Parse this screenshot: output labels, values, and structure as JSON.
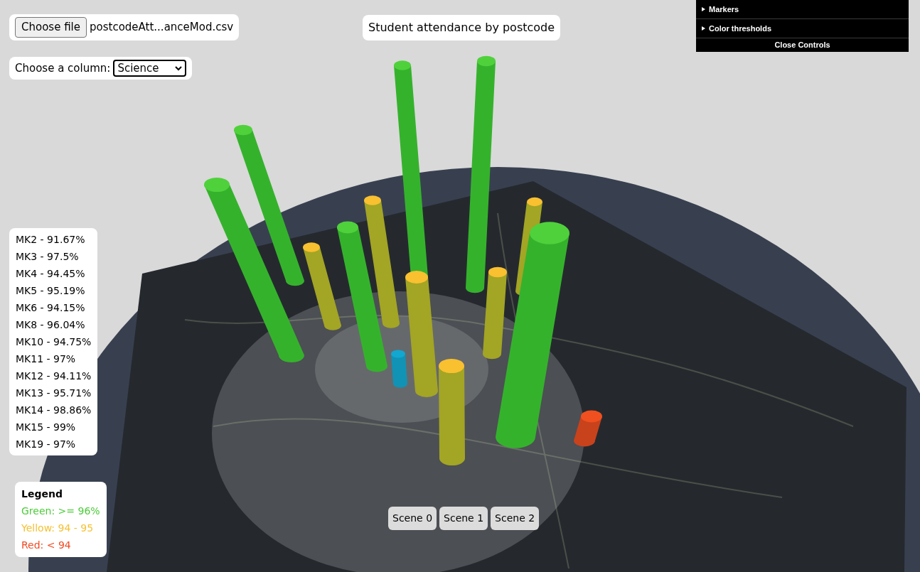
{
  "file_input": {
    "button": "Choose file",
    "filename": "postcodeAtt...anceMod.csv"
  },
  "title": "Student attendance by postcode",
  "controls": {
    "folders": [
      {
        "label": "Markers",
        "expanded": false
      },
      {
        "label": "Color thresholds",
        "expanded": false
      }
    ],
    "close": "Close Controls"
  },
  "column_select": {
    "label": "Choose a column:",
    "value": "Science"
  },
  "postcodes": [
    "MK2 - 91.67%",
    "MK3 - 97.5%",
    "MK4 - 94.45%",
    "MK5 - 95.19%",
    "MK6 - 94.15%",
    "MK8 - 96.04%",
    "MK10 - 94.75%",
    "MK11 - 97%",
    "MK12 - 94.11%",
    "MK13 - 95.71%",
    "MK14 - 98.86%",
    "MK15 - 99%",
    "MK19 - 97%"
  ],
  "legend": {
    "title": "Legend",
    "items": [
      {
        "label": "Green: >= 96%",
        "color": "#4ccc3a"
      },
      {
        "label": "Yellow: 94 - 95",
        "color": "#f5c133"
      },
      {
        "label": "Red: < 94",
        "color": "#ef4b23"
      }
    ]
  },
  "scenes": [
    {
      "label": "Scene 0"
    },
    {
      "label": "Scene 1"
    },
    {
      "label": "Scene 2"
    }
  ]
}
